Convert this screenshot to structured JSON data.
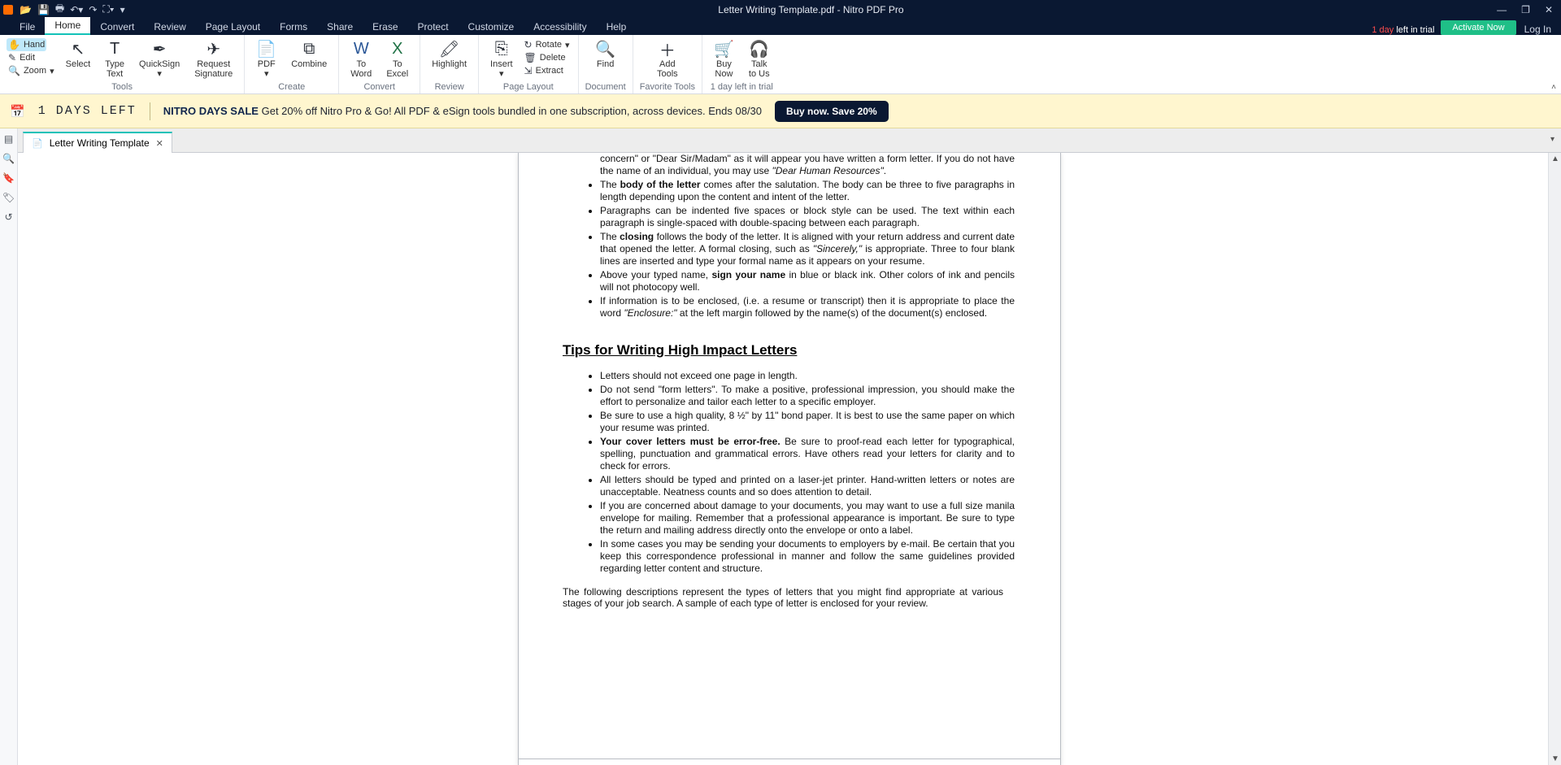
{
  "window": {
    "title": "Letter Writing Template.pdf - Nitro PDF Pro"
  },
  "menus": {
    "file": "File",
    "home": "Home",
    "convert": "Convert",
    "review": "Review",
    "pagelayout": "Page Layout",
    "forms": "Forms",
    "share": "Share",
    "erase": "Erase",
    "protect": "Protect",
    "customize": "Customize",
    "accessibility": "Accessibility",
    "help": "Help"
  },
  "trial": {
    "days": "1 day",
    "rest": " left in trial",
    "activate": "Activate Now",
    "login": "Log In"
  },
  "ribbon": {
    "hand": "Hand",
    "edit": "Edit",
    "zoom": "Zoom",
    "select": "Select",
    "typetext": "Type\nText",
    "quicksign": "QuickSign",
    "reqsig": "Request\nSignature",
    "pdf": "PDF",
    "combine": "Combine",
    "toword": "To\nWord",
    "toexcel": "To\nExcel",
    "highlight": "Highlight",
    "insert": "Insert",
    "rotate": "Rotate",
    "delete": "Delete",
    "extract": "Extract",
    "find": "Find",
    "addtools": "Add\nTools",
    "buynow": "Buy\nNow",
    "talk": "Talk\nto Us",
    "groups": {
      "tools": "Tools",
      "create": "Create",
      "convert": "Convert",
      "review": "Review",
      "pagelayout": "Page Layout",
      "document": "Document",
      "fav": "Favorite Tools",
      "trial": "1 day left in trial"
    }
  },
  "promo": {
    "daysleft": "1 DAYS LEFT",
    "title": "NITRO DAYS SALE",
    "body": " Get 20% off Nitro Pro & Go! All PDF & eSign tools bundled in one subscription, across devices. Ends 08/30",
    "cta": "Buy now. Save 20%"
  },
  "doctab": {
    "name": "Letter Writing Template"
  },
  "doc": {
    "frag1a": "concern\" or \"Dear Sir/Madam\" as it will appear you have written a form letter.  If you do not have the name of an individual, you may use ",
    "frag1b": "\"Dear Human Resources\"",
    "frag1c": ".",
    "li2a": "The ",
    "li2b": "body of the letter",
    "li2c": " comes after the salutation.  The body can be three to five paragraphs in length depending upon the content and intent of the letter.",
    "li3": "Paragraphs can be indented five spaces or block style can be used.  The text within each paragraph is single-spaced with double-spacing between each paragraph.",
    "li4a": "The ",
    "li4b": "closing",
    "li4c": " follows the body of the letter.  It is aligned with your return address and current date that opened the letter. A formal closing, such as ",
    "li4d": "\"Sincerely,\"",
    "li4e": " is appropriate.  Three to four blank lines are inserted and type your formal name as it appears on your resume.",
    "li5a": "Above your typed name, ",
    "li5b": "sign your name",
    "li5c": " in blue or black ink.  Other colors of ink and pencils will not photocopy well.",
    "li6a": "If information is to be enclosed, (i.e. a resume or transcript) then it is appropriate to place the word ",
    "li6b": "\"Enclosure:\"",
    "li6c": " at the left margin followed by the name(s) of the document(s) enclosed.",
    "h2": "Tips for Writing High Impact Letters",
    "t1": "Letters should not exceed one page in length.",
    "t2": "Do not send \"form letters\".  To make a positive, professional impression, you should make the effort to personalize and tailor each letter to a specific employer.",
    "t3": "Be sure to use a high quality, 8 ½\" by 11\" bond paper.  It is best to use the same paper on which your resume was printed.",
    "t4a": "Your cover letters must be error-free.",
    "t4b": "  Be sure to proof-read each letter for typographical, spelling, punctuation and grammatical errors.  Have others read your letters for clarity and to check for errors.",
    "t5": "All letters should be typed and printed on a laser-jet printer. Hand-written letters or notes are unacceptable.  Neatness counts and so does attention to detail.",
    "t6": "If you are concerned about damage to your documents, you may want to use a full size manila envelope for mailing. Remember that a professional appearance is important.  Be sure to type the return and mailing address directly onto the envelope or onto a label.",
    "t7": "In some cases you may be sending your documents to employers by e-mail.  Be certain that you keep this correspondence professional in manner and follow the same guidelines provided regarding letter content and structure.",
    "closing": "The following descriptions represent the types of letters that you might find appropriate at various stages of your job search.  A sample of each type of letter is enclosed for your review."
  }
}
